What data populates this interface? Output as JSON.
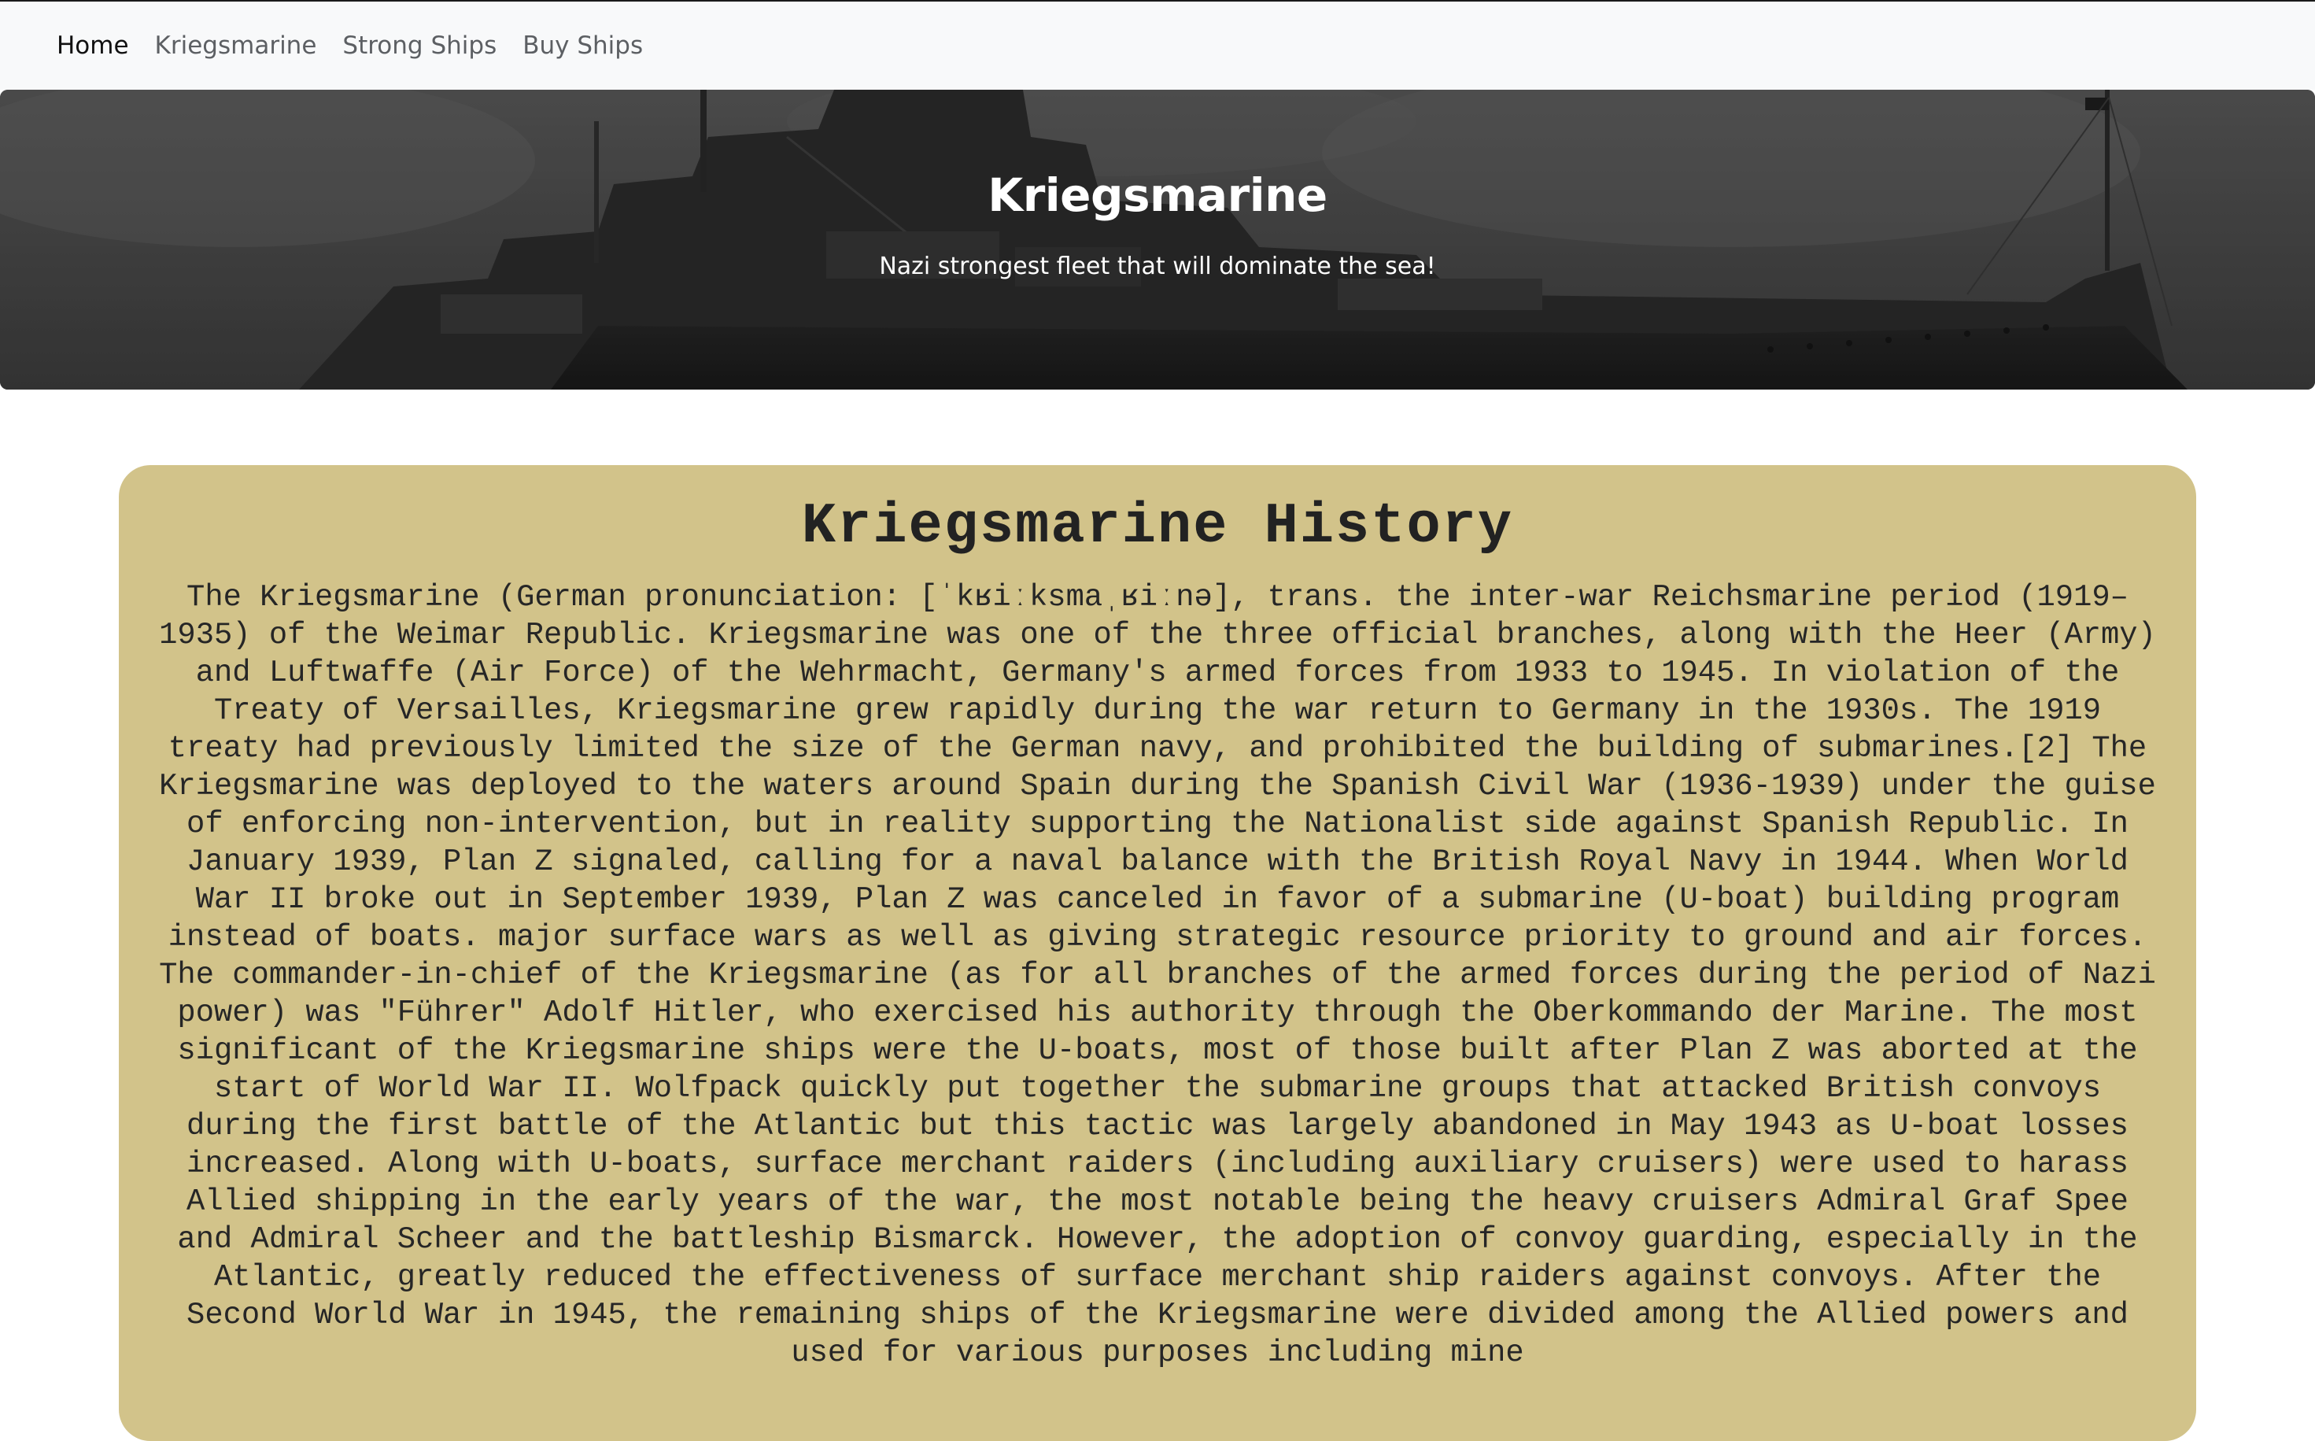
{
  "nav": {
    "items": [
      {
        "label": "Home",
        "active": true
      },
      {
        "label": "Kriegsmarine",
        "active": false
      },
      {
        "label": "Strong Ships",
        "active": false
      },
      {
        "label": "Buy Ships",
        "active": false
      }
    ]
  },
  "hero": {
    "title": "Kriegsmarine",
    "subtitle": "Nazi strongest fleet that will dominate the sea!",
    "image_description_icon": "battleship-photo"
  },
  "history": {
    "title": "Kriegsmarine History",
    "body": "The Kriegsmarine (German pronunciation: [ˈkʁiːksmaˌʁiːnə], trans. the inter-war Reichsmarine period (1919–1935) of the Weimar Republic. Kriegsmarine was one of the three official branches, along with the Heer (Army) and Luftwaffe (Air Force) of the Wehrmacht, Germany's armed forces from 1933 to 1945. In violation of the Treaty of Versailles, Kriegsmarine grew rapidly during the war return to Germany in the 1930s. The 1919 treaty had previously limited the size of the German navy, and prohibited the building of submarines.[2] The Kriegsmarine was deployed to the waters around Spain during the Spanish Civil War (1936-1939) under the guise of enforcing non-intervention, but in reality supporting the Nationalist side against Spanish Republic. In January 1939, Plan Z signaled, calling for a naval balance with the British Royal Navy in 1944. When World War II broke out in September 1939, Plan Z was canceled in favor of a submarine (U-boat) building program instead of boats. major surface wars as well as giving strategic resource priority to ground and air forces. The commander-in-chief of the Kriegsmarine (as for all branches of the armed forces during the period of Nazi power) was \"Führer\" Adolf Hitler, who exercised his authority through the Oberkommando der Marine. The most significant of the Kriegsmarine ships were the U-boats, most of those built after Plan Z was aborted at the start of World War II. Wolfpack quickly put together the submarine groups that attacked British convoys during the first battle of the Atlantic but this tactic was largely abandoned in May 1943 as U-boat losses increased. Along with U-boats, surface merchant raiders (including auxiliary cruisers) were used to harass Allied shipping in the early years of the war, the most notable being the heavy cruisers Admiral Graf Spee and Admiral Scheer and the battleship Bismarck. However, the adoption of convoy guarding, especially in the Atlantic, greatly reduced the effectiveness of surface merchant ship raiders against convoys. After the Second World War in 1945, the remaining ships of the Kriegsmarine were divided among the Allied powers and used for various purposes including mine"
  },
  "colors": {
    "navbar_bg": "#f8f9fa",
    "card_bg": "#d2c38a",
    "hero_overlay": "#3f3f3f"
  }
}
